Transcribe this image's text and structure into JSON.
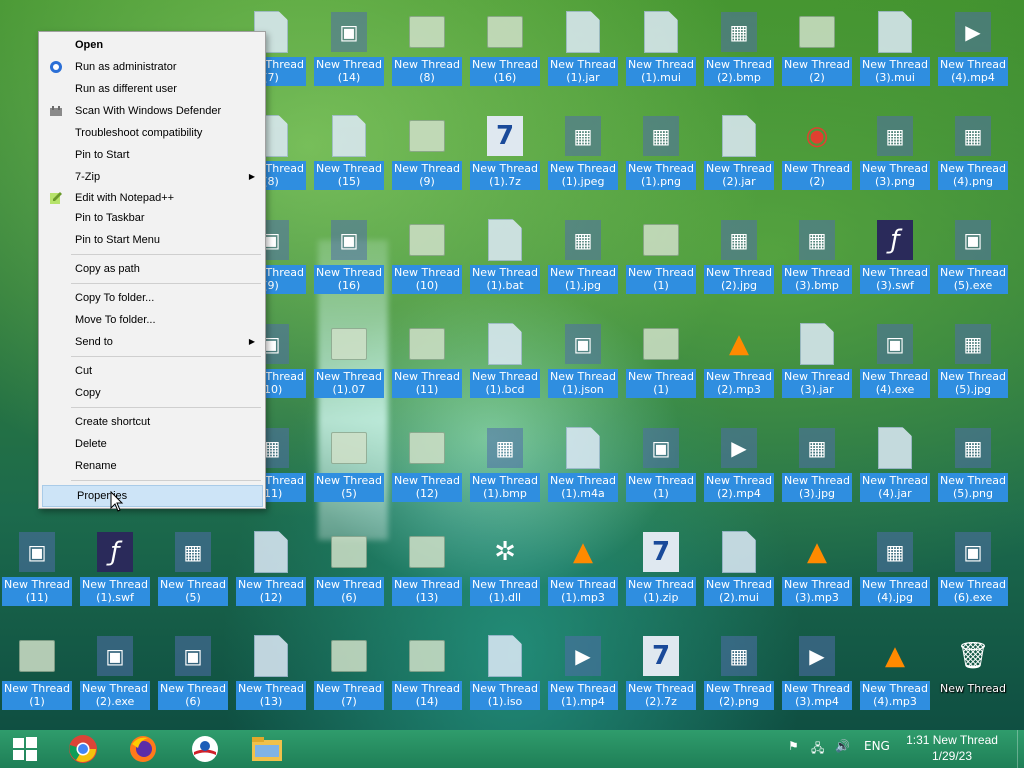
{
  "desktop": {
    "icons": [
      {
        "label": "New Thread\n(7)",
        "type": "doc"
      },
      {
        "label": "New Thread\n(14)",
        "type": "app"
      },
      {
        "label": "New Thread\n(8)",
        "type": "folder"
      },
      {
        "label": "New Thread\n(16)",
        "type": "folder"
      },
      {
        "label": "New Thread\n(1).jar",
        "type": "doc"
      },
      {
        "label": "New Thread\n(1).mui",
        "type": "doc"
      },
      {
        "label": "New Thread\n(2).bmp",
        "type": "img"
      },
      {
        "label": "New Thread\n(2)",
        "type": "folder"
      },
      {
        "label": "New Thread\n(3).mui",
        "type": "doc"
      },
      {
        "label": "New Thread\n(4).mp4",
        "type": "video"
      },
      {
        "label": "New Thread\n(8)",
        "type": "doc"
      },
      {
        "label": "New Thread\n(15)",
        "type": "doc"
      },
      {
        "label": "New Thread\n(9)",
        "type": "folder"
      },
      {
        "label": "New Thread\n(1).7z",
        "type": "zip"
      },
      {
        "label": "New Thread\n(1).jpeg",
        "type": "img"
      },
      {
        "label": "New Thread\n(1).png",
        "type": "img"
      },
      {
        "label": "New Thread\n(2).jar",
        "type": "doc"
      },
      {
        "label": "New Thread\n(2)",
        "type": "chrome"
      },
      {
        "label": "New Thread\n(3).png",
        "type": "img"
      },
      {
        "label": "New Thread\n(4).png",
        "type": "img"
      },
      {
        "label": "New Thread\n(9)",
        "type": "app"
      },
      {
        "label": "New Thread\n(16)",
        "type": "app"
      },
      {
        "label": "New Thread\n(10)",
        "type": "folder"
      },
      {
        "label": "New Thread\n(1).bat",
        "type": "doc"
      },
      {
        "label": "New Thread\n(1).jpg",
        "type": "img"
      },
      {
        "label": "New Thread\n(1)",
        "type": "folder"
      },
      {
        "label": "New Thread\n(2).jpg",
        "type": "img"
      },
      {
        "label": "New Thread\n(3).bmp",
        "type": "img"
      },
      {
        "label": "New Thread\n(3).swf",
        "type": "flash"
      },
      {
        "label": "New Thread\n(5).exe",
        "type": "app"
      },
      {
        "label": "New Thread\n(10)",
        "type": "app"
      },
      {
        "label": "New Thread\n(1).07",
        "type": "folder"
      },
      {
        "label": "New Thread\n(11)",
        "type": "folder"
      },
      {
        "label": "New Thread\n(1).bcd",
        "type": "doc"
      },
      {
        "label": "New Thread\n(1).json",
        "type": "app"
      },
      {
        "label": "New Thread\n(1)",
        "type": "folder"
      },
      {
        "label": "New Thread\n(2).mp3",
        "type": "vlc"
      },
      {
        "label": "New Thread\n(3).jar",
        "type": "doc"
      },
      {
        "label": "New Thread\n(4).exe",
        "type": "app"
      },
      {
        "label": "New Thread\n(5).jpg",
        "type": "img"
      },
      {
        "label": "New Thread\n(11)",
        "type": "img"
      },
      {
        "label": "New Thread\n(5)",
        "type": "folder"
      },
      {
        "label": "New Thread\n(12)",
        "type": "folder"
      },
      {
        "label": "New Thread\n(1).bmp",
        "type": "img"
      },
      {
        "label": "New Thread\n(1).m4a",
        "type": "doc"
      },
      {
        "label": "New Thread\n(1)",
        "type": "app"
      },
      {
        "label": "New Thread\n(2).mp4",
        "type": "video"
      },
      {
        "label": "New Thread\n(3).jpg",
        "type": "img"
      },
      {
        "label": "New Thread\n(4).jar",
        "type": "doc"
      },
      {
        "label": "New Thread\n(5).png",
        "type": "img"
      },
      {
        "label": "New Thread\n(11)",
        "type": "app"
      },
      {
        "label": "New Thread\n(1).swf",
        "type": "flash"
      },
      {
        "label": "New Thread\n(5)",
        "type": "img"
      },
      {
        "label": "New Thread\n(12)",
        "type": "doc"
      },
      {
        "label": "New Thread\n(6)",
        "type": "folder"
      },
      {
        "label": "New Thread\n(13)",
        "type": "folder"
      },
      {
        "label": "New Thread\n(1).dll",
        "type": "gear"
      },
      {
        "label": "New Thread\n(1).mp3",
        "type": "vlc"
      },
      {
        "label": "New Thread\n(1).zip",
        "type": "zip"
      },
      {
        "label": "New Thread\n(2).mui",
        "type": "doc"
      },
      {
        "label": "New Thread\n(3).mp3",
        "type": "vlc"
      },
      {
        "label": "New Thread\n(4).jpg",
        "type": "img"
      },
      {
        "label": "New Thread\n(6).exe",
        "type": "app"
      },
      {
        "label": "New Thread\n(1)",
        "type": "folder"
      },
      {
        "label": "New Thread\n(2).exe",
        "type": "app"
      },
      {
        "label": "New Thread\n(6)",
        "type": "app"
      },
      {
        "label": "New Thread\n(13)",
        "type": "doc"
      },
      {
        "label": "New Thread\n(7)",
        "type": "folder"
      },
      {
        "label": "New Thread\n(14)",
        "type": "folder"
      },
      {
        "label": "New Thread\n(1).iso",
        "type": "doc"
      },
      {
        "label": "New Thread\n(1).mp4",
        "type": "video"
      },
      {
        "label": "New Thread\n(2).7z",
        "type": "zip"
      },
      {
        "label": "New Thread\n(2).png",
        "type": "img"
      },
      {
        "label": "New Thread\n(3).mp4",
        "type": "video"
      },
      {
        "label": "New Thread\n(4).mp3",
        "type": "vlc"
      },
      {
        "label": "New Thread",
        "type": "recycle"
      }
    ]
  },
  "context_menu": {
    "items": [
      {
        "label": "Open",
        "bold": true
      },
      {
        "label": "Run as administrator",
        "icon": "shield-icon"
      },
      {
        "label": "Run as different user"
      },
      {
        "label": "Scan With Windows Defender",
        "icon": "defender-icon"
      },
      {
        "label": "Troubleshoot compatibility"
      },
      {
        "label": "Pin to Start"
      },
      {
        "label": "7-Zip",
        "submenu": true
      },
      {
        "label": "Edit with Notepad++",
        "icon": "notepadpp-icon"
      },
      {
        "label": "Pin to Taskbar"
      },
      {
        "label": "Pin to Start Menu"
      },
      {
        "label": "Copy as path"
      },
      {
        "label": "Copy To folder..."
      },
      {
        "label": "Move To folder..."
      },
      {
        "label": "Send to",
        "submenu": true
      },
      {
        "label": "Cut"
      },
      {
        "label": "Copy"
      },
      {
        "label": "Create shortcut"
      },
      {
        "label": "Delete"
      },
      {
        "label": "Rename"
      },
      {
        "label": "Properties",
        "highlighted": true
      }
    ]
  },
  "taskbar": {
    "language": "ENG",
    "time": "1:31 New Thread",
    "date": "1/29/23"
  }
}
